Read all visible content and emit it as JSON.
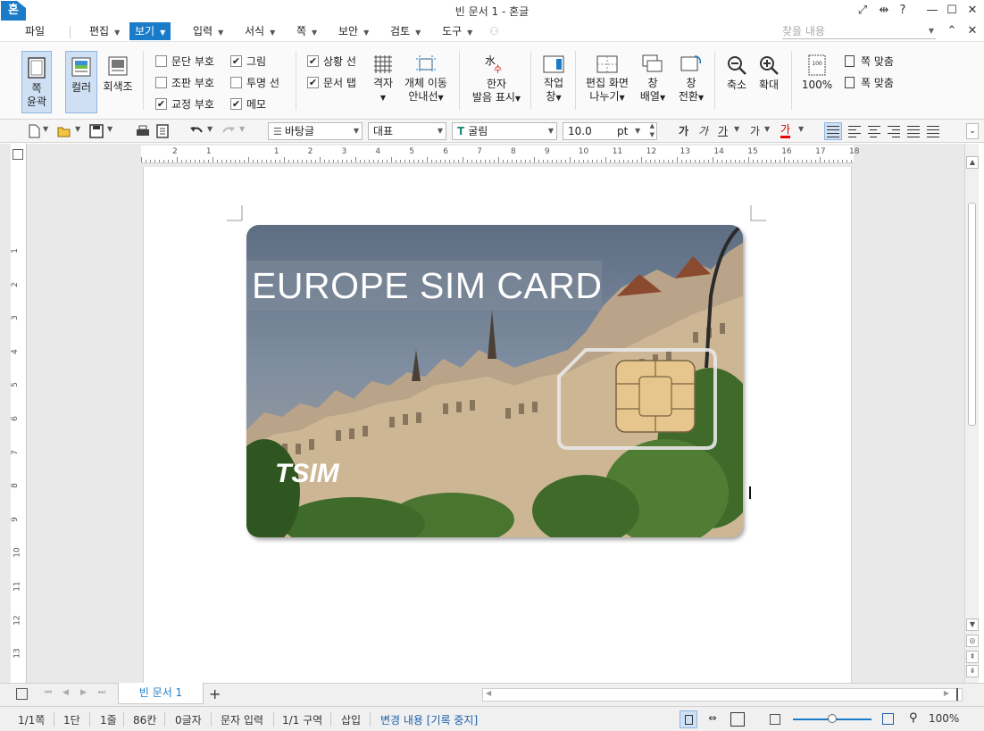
{
  "window": {
    "title": "빈 문서 1 - 혼글",
    "app_icon": "혼",
    "buttons": [
      "expand-icon",
      "arrows-icon",
      "help-icon",
      "minimize-icon",
      "maximize-icon",
      "close-icon"
    ],
    "help_label": "?"
  },
  "menu": {
    "items": [
      "파일",
      "편집",
      "보기",
      "입력",
      "서식",
      "쪽",
      "보안",
      "검토",
      "도구"
    ],
    "active": "보기",
    "search_placeholder": "찾을 내용"
  },
  "ribbon": {
    "page_outline": [
      "쪽",
      "윤곽"
    ],
    "color": "컬러",
    "grayscale": "회색조",
    "checkboxes_col1": [
      {
        "label": "문단 부호",
        "checked": false
      },
      {
        "label": "조판 부호",
        "checked": false
      },
      {
        "label": "교정 부호",
        "checked": true
      }
    ],
    "checkboxes_col2": [
      {
        "label": "그림",
        "checked": true
      },
      {
        "label": "투명 선",
        "checked": false
      },
      {
        "label": "메모",
        "checked": true
      }
    ],
    "checkboxes_col3": [
      {
        "label": "상황 선",
        "checked": true
      },
      {
        "label": "문서 탭",
        "checked": true
      }
    ],
    "grid": "격자",
    "object_move": [
      "개체 이동",
      "안내선"
    ],
    "hanja": [
      "한자",
      "발음 표시"
    ],
    "hanja_icon_top": "水",
    "hanja_icon_bottom": "수",
    "work_window": [
      "작업",
      "창"
    ],
    "split_screen": [
      "편집 화면",
      "나누기"
    ],
    "arrange": [
      "창",
      "배열"
    ],
    "switch": [
      "창",
      "전환"
    ],
    "zoom_out": "축소",
    "zoom_in": "확대",
    "zoom_percent": "100%",
    "fit_page": "쪽 맞춤",
    "fit_width": "폭 맞춤"
  },
  "toolbar": {
    "style": "바탕글",
    "font_group": "대표",
    "font": "굴림",
    "font_size": "10.0",
    "unit": "pt",
    "formats": [
      "가",
      "가",
      "가",
      "가",
      "가"
    ]
  },
  "document": {
    "ruler_h": [
      "2",
      "1",
      "",
      "1",
      "2",
      "3",
      "4",
      "5",
      "6",
      "7",
      "8",
      "9",
      "10",
      "11",
      "12",
      "13",
      "14",
      "15",
      "16",
      "17",
      "18"
    ],
    "ruler_v": [
      "1",
      "2",
      "3",
      "4",
      "5",
      "6",
      "7",
      "8",
      "9",
      "10",
      "11",
      "12",
      "13"
    ],
    "card": {
      "title": "EUROPE SIM CARD",
      "logo": "TSIM"
    }
  },
  "tabs": {
    "doc_tab": "빈 문서 1",
    "add": "+"
  },
  "status": {
    "page": "1/1쪽",
    "column": "1단",
    "line": "1줄",
    "pos": "86칸",
    "chars": "0글자",
    "mode": "문자 입력",
    "section": "1/1 구역",
    "insert": "삽입",
    "track": "변경 내용 [기록 중지]",
    "zoom": "100%",
    "zoom_level": 0.5
  },
  "colors": {
    "accent": "#1a7cc9",
    "ribbon_select": "#cfe0f5"
  }
}
